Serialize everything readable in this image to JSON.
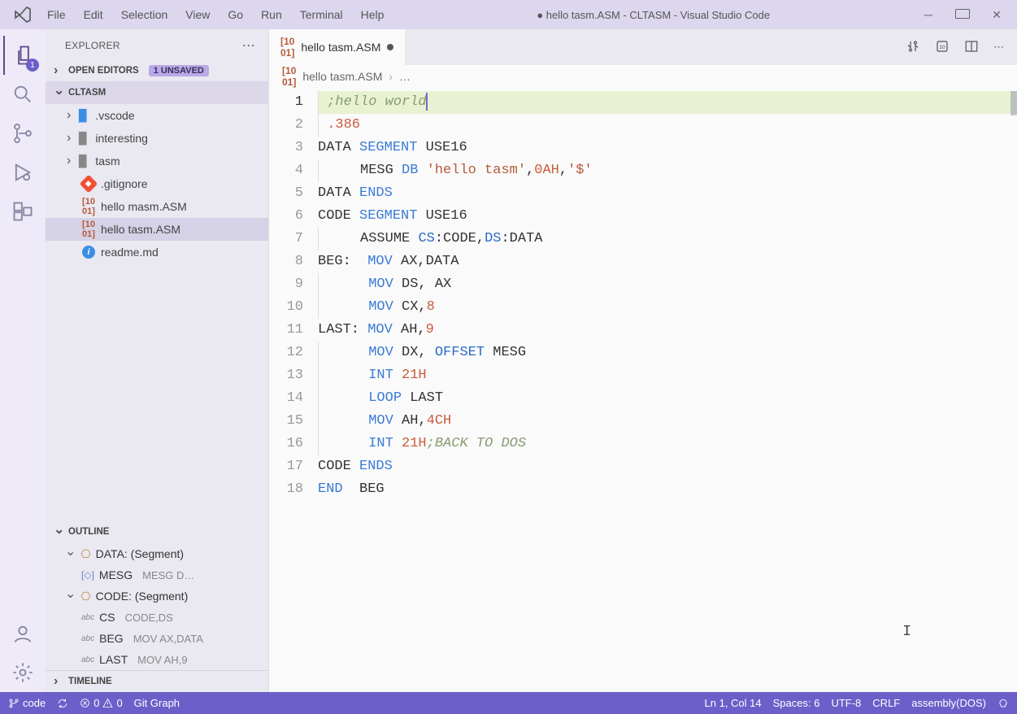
{
  "titlebar": {
    "menu": [
      "File",
      "Edit",
      "Selection",
      "View",
      "Go",
      "Run",
      "Terminal",
      "Help"
    ],
    "title": "● hello tasm.ASM - CLTASM - Visual Studio Code"
  },
  "activitybar": {
    "explorer_badge": "1"
  },
  "sidebar": {
    "header": "EXPLORER",
    "open_editors": {
      "label": "Open Editors",
      "unsaved": "1 UNSAVED"
    },
    "workspace": "CLTASM",
    "tree": [
      {
        "type": "folder",
        "name": ".vscode",
        "icon": "blue"
      },
      {
        "type": "folder",
        "name": "interesting",
        "icon": "grey"
      },
      {
        "type": "folder",
        "name": "tasm",
        "icon": "grey"
      },
      {
        "type": "file",
        "name": ".gitignore",
        "icon": "git"
      },
      {
        "type": "file",
        "name": "hello masm.ASM",
        "icon": "asm"
      },
      {
        "type": "file",
        "name": "hello tasm.ASM",
        "icon": "asm",
        "selected": true
      },
      {
        "type": "file",
        "name": "readme.md",
        "icon": "info"
      }
    ],
    "outline": {
      "label": "Outline",
      "items": [
        {
          "kind": "seg",
          "name": "DATA: (Segment)",
          "children": [
            {
              "kind": "brk",
              "name": "MESG",
              "detail": "MESG D…"
            }
          ]
        },
        {
          "kind": "seg",
          "name": "CODE: (Segment)",
          "children": [
            {
              "kind": "abc",
              "name": "CS",
              "detail": "CODE,DS"
            },
            {
              "kind": "abc",
              "name": "BEG",
              "detail": "MOV AX,DATA"
            },
            {
              "kind": "abc",
              "name": "LAST",
              "detail": "MOV AH,9"
            }
          ]
        }
      ]
    },
    "timeline": "Timeline"
  },
  "editor": {
    "tab": {
      "filename": "hello tasm.ASM",
      "dirty": true
    },
    "breadcrumb": {
      "file": "hello tasm.ASM",
      "rest": "…"
    },
    "line_numbers": [
      1,
      2,
      3,
      4,
      5,
      6,
      7,
      8,
      9,
      10,
      11,
      12,
      13,
      14,
      15,
      16,
      17,
      18
    ],
    "active_line": 1,
    "code": {
      "l1": {
        "comment": ";hello world"
      },
      "l2": {
        "dir": ".386"
      },
      "l3": {
        "a": "DATA ",
        "b": "SEGMENT ",
        "c": "USE16"
      },
      "l4": {
        "pad": "     ",
        "a": "MESG ",
        "b": "DB ",
        "c": "'hello tasm'",
        "d": ",",
        "e": "0AH",
        "f": ",",
        "g": "'$'"
      },
      "l5": {
        "a": "DATA ",
        "b": "ENDS"
      },
      "l6": {
        "a": "CODE ",
        "b": "SEGMENT ",
        "c": "USE16"
      },
      "l7": {
        "pad": "     ",
        "a": "ASSUME ",
        "b": "CS",
        "c": ":CODE,",
        "d": "DS",
        "e": ":DATA"
      },
      "l8": {
        "a": "BEG:  ",
        "b": "MOV ",
        "c": "AX,DATA"
      },
      "l9": {
        "pad": "      ",
        "b": "MOV ",
        "c": "DS, AX"
      },
      "l10": {
        "pad": "      ",
        "b": "MOV ",
        "c": "CX,",
        "d": "8"
      },
      "l11": {
        "a": "LAST: ",
        "b": "MOV ",
        "c": "AH,",
        "d": "9"
      },
      "l12": {
        "pad": "      ",
        "b": "MOV ",
        "c": "DX, ",
        "d": "OFFSET ",
        "e": "MESG"
      },
      "l13": {
        "pad": "      ",
        "b": "INT ",
        "c": "21H"
      },
      "l14": {
        "pad": "      ",
        "b": "LOOP ",
        "c": "LAST"
      },
      "l15": {
        "pad": "      ",
        "b": "MOV ",
        "c": "AH,",
        "d": "4CH"
      },
      "l16": {
        "pad": "      ",
        "b": "INT ",
        "c": "21H",
        "cm": ";BACK TO DOS"
      },
      "l17": {
        "a": "CODE ",
        "b": "ENDS"
      },
      "l18": {
        "a": "END  ",
        "b": "BEG"
      }
    }
  },
  "statusbar": {
    "branch": "code",
    "errors": "0",
    "warnings": "0",
    "gitgraph": "Git Graph",
    "position": "Ln 1, Col 14",
    "spaces": "Spaces: 6",
    "encoding": "UTF-8",
    "eol": "CRLF",
    "lang": "assembly(DOS)"
  }
}
